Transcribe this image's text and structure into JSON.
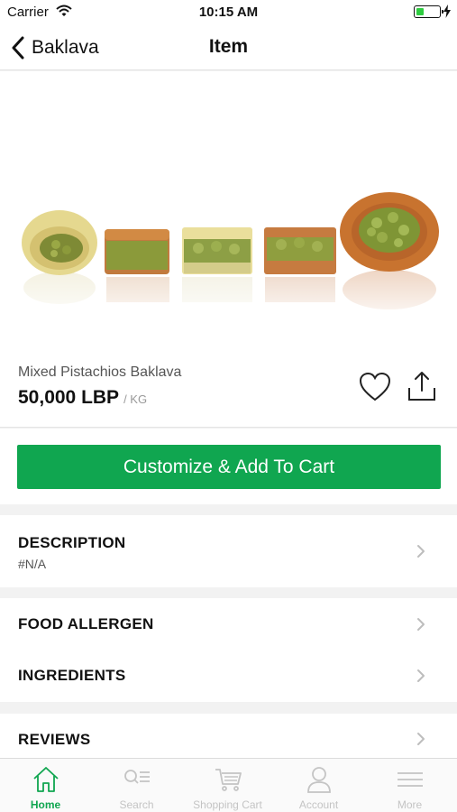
{
  "status_bar": {
    "carrier": "Carrier",
    "time": "10:15 AM",
    "battery_level": 0.35,
    "battery_color": "#2ecc40"
  },
  "nav": {
    "back_label": "Baklava",
    "title": "Item"
  },
  "hero_image": {
    "description_icon": "baklava-photo"
  },
  "product": {
    "name": "Mixed Pistachios Baklava",
    "price": "50,000 LBP",
    "unit": "/ KG"
  },
  "actions": {
    "favorite_icon": "heart-icon",
    "share_icon": "share-icon",
    "add_to_cart_label": "Customize & Add To Cart",
    "accent_color": "#10a650"
  },
  "sections": {
    "description": {
      "title": "DESCRIPTION",
      "value": "#N/A"
    },
    "food_allergen": {
      "title": "FOOD ALLERGEN"
    },
    "ingredients": {
      "title": "INGREDIENTS"
    },
    "reviews": {
      "title": "REVIEWS"
    }
  },
  "tab_bar": {
    "tabs": [
      {
        "label": "Home",
        "icon": "home-icon",
        "active": true
      },
      {
        "label": "Search",
        "icon": "search-icon",
        "active": false
      },
      {
        "label": "Shopping Cart",
        "icon": "cart-icon",
        "active": false
      },
      {
        "label": "Account",
        "icon": "account-icon",
        "active": false
      },
      {
        "label": "More",
        "icon": "menu-icon",
        "active": false
      }
    ]
  }
}
